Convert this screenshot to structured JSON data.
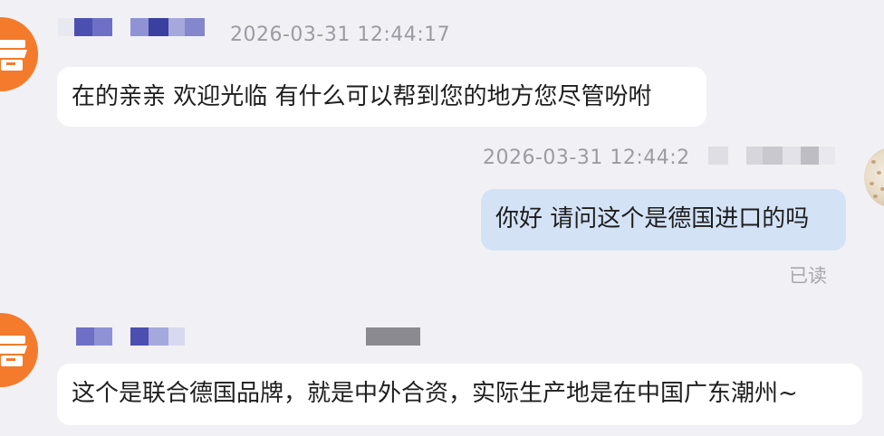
{
  "colors": {
    "background": "#f1f1f5",
    "incoming_bubble": "#ffffff",
    "outgoing_bubble": "#d4e2f6",
    "shop_avatar": "#f37b2b",
    "timestamp": "#9b9ba3",
    "name_blur": "#3b3fa0"
  },
  "messages": [
    {
      "direction": "incoming",
      "sender_avatar": "shop-avatar-icon",
      "timestamp": "2026-03-31 12:44:17",
      "text": "在的亲亲 欢迎光临 有什么可以帮到您的地方您尽管吩咐"
    },
    {
      "direction": "outgoing",
      "sender_avatar": "user-avatar",
      "timestamp": "2026-03-31 12:44:2",
      "text": "你好 请问这个是德国进口的吗",
      "status": "已读"
    },
    {
      "direction": "incoming",
      "sender_avatar": "shop-avatar-icon",
      "timestamp": "",
      "text": "这个是联合德国品牌，就是中外合资，实际生产地是在中国广东潮州~"
    }
  ]
}
